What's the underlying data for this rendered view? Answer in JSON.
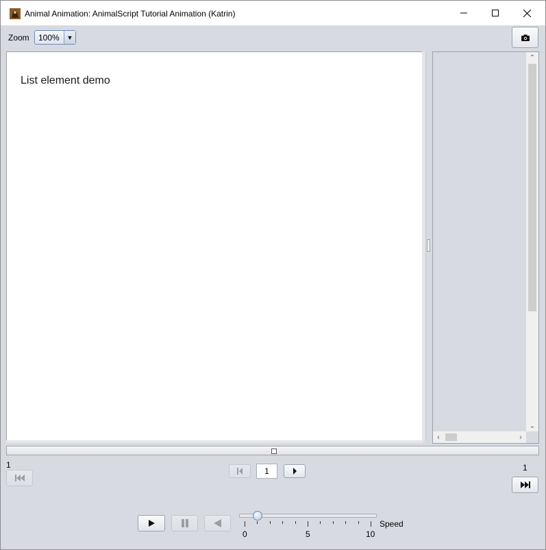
{
  "window": {
    "title": "Animal Animation: AnimalScript Tutorial Animation (Katrin)",
    "app_icon": "animal-app-icon",
    "controls": [
      "minimize-icon",
      "maximize-icon",
      "close-icon"
    ]
  },
  "toolbar": {
    "zoom_label": "Zoom",
    "zoom_value": "100%",
    "snapshot_icon": "camera-icon"
  },
  "canvas": {
    "text": "List element demo",
    "background": "#ffffff"
  },
  "navigation": {
    "first_step_number": "1",
    "last_step_number": "1",
    "current_step": "1",
    "buttons": {
      "first": {
        "icon": "skip-to-start-icon",
        "enabled": false
      },
      "prev": {
        "icon": "step-back-icon",
        "enabled": false
      },
      "next": {
        "icon": "step-forward-icon",
        "enabled": true
      },
      "last": {
        "icon": "skip-to-end-icon",
        "enabled": true
      }
    }
  },
  "playback": {
    "play": {
      "icon": "play-icon",
      "enabled": true
    },
    "pause": {
      "icon": "pause-icon",
      "enabled": false
    },
    "reverse": {
      "icon": "play-reverse-icon",
      "enabled": false
    }
  },
  "speed": {
    "label": "Speed",
    "min": 0,
    "max": 10,
    "value": 1,
    "tick_labels": [
      "0",
      "5",
      "10"
    ]
  },
  "colors": {
    "window_bg": "#d7dae1",
    "accent": "#6d8bb3"
  }
}
